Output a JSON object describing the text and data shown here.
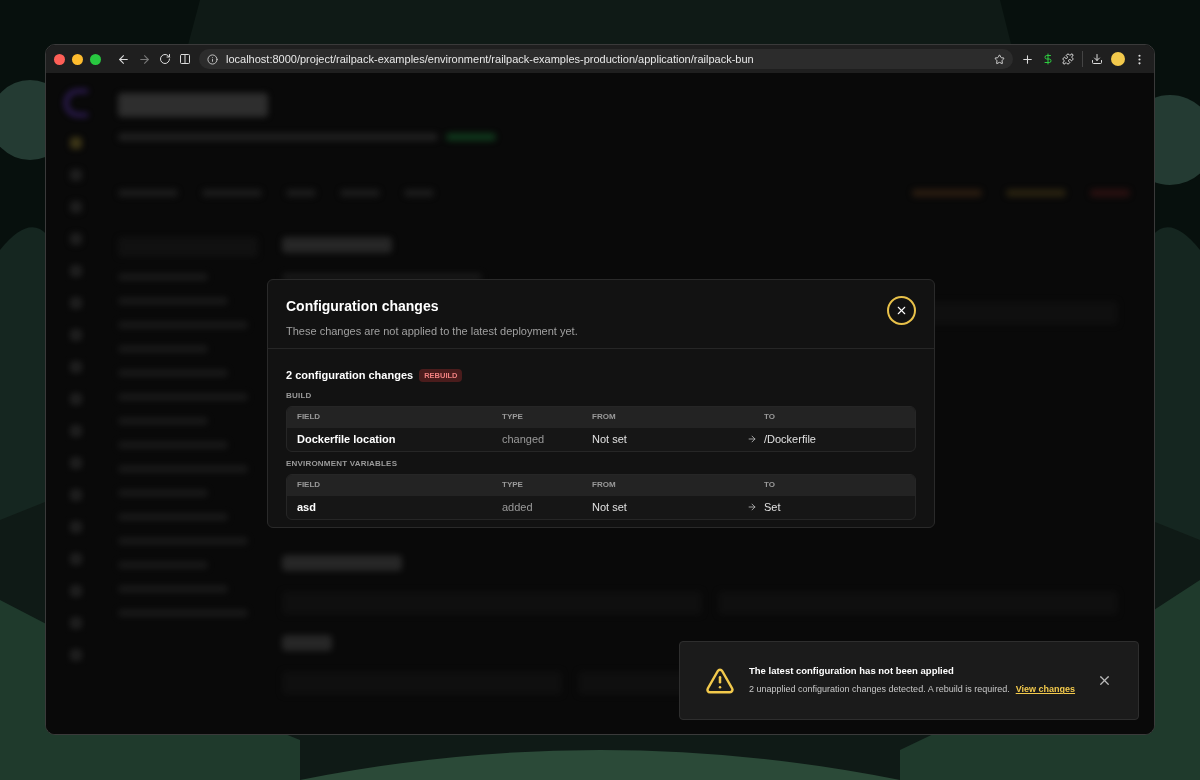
{
  "browser": {
    "url": "localhost:8000/project/railpack-examples/environment/railpack-examples-production/application/railpack-bun"
  },
  "dialog": {
    "title": "Configuration changes",
    "subtitle": "These changes are not applied to the latest deployment yet.",
    "summary": "2 configuration changes",
    "badge": "REBUILD",
    "groups": [
      {
        "heading": "BUILD",
        "columns": [
          "FIELD",
          "TYPE",
          "FROM",
          "TO"
        ],
        "rows": [
          {
            "field": "Dockerfile location",
            "type": "changed",
            "from": "Not set",
            "to": "/Dockerfile"
          }
        ]
      },
      {
        "heading": "ENVIRONMENT VARIABLES",
        "columns": [
          "FIELD",
          "TYPE",
          "FROM",
          "TO"
        ],
        "rows": [
          {
            "field": "asd",
            "type": "added",
            "from": "Not set",
            "to": "Set"
          }
        ]
      }
    ]
  },
  "toast": {
    "title": "The latest configuration has not been applied",
    "message": "2 unapplied configuration changes detected. A rebuild is required.",
    "link": "View changes"
  }
}
